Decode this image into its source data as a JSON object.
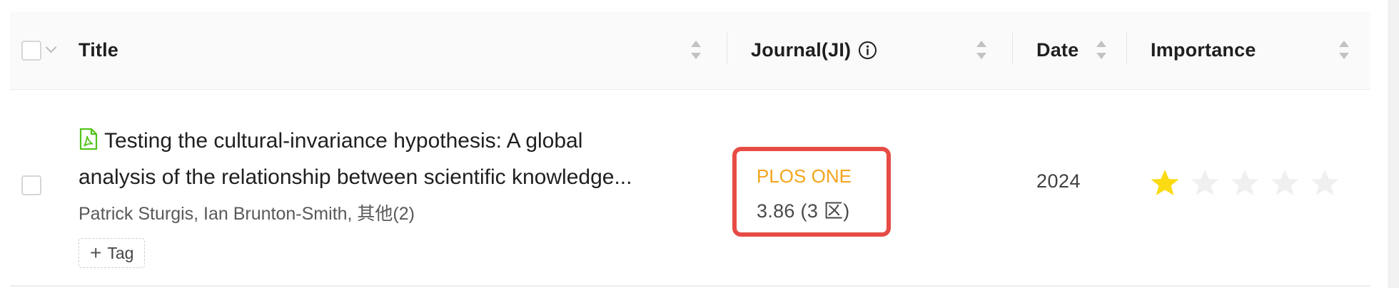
{
  "header": {
    "title": "Title",
    "journal": "Journal(JI)",
    "date": "Date",
    "importance": "Importance"
  },
  "row": {
    "title_line1": "Testing the cultural-invariance hypothesis: A global",
    "title_line2": "analysis of the relationship between scientific knowledge...",
    "authors": "Patrick Sturgis, Ian Brunton-Smith, 其他(2)",
    "tag_label": "Tag",
    "journal_name": "PLOS ONE",
    "journal_metric": "3.86 (3 区)",
    "date": "2024",
    "importance_rating": 1,
    "importance_max": 5
  },
  "colors": {
    "star_filled": "#fadb14",
    "star_empty": "#f0f0f0",
    "journal_name": "#f4a51c",
    "highlight_border": "#e74b45",
    "pdf_icon": "#52c41a"
  },
  "icons": [
    "chevron-down-icon",
    "sort-icon",
    "info-icon",
    "pdf-file-icon",
    "plus-icon",
    "star-icon"
  ]
}
